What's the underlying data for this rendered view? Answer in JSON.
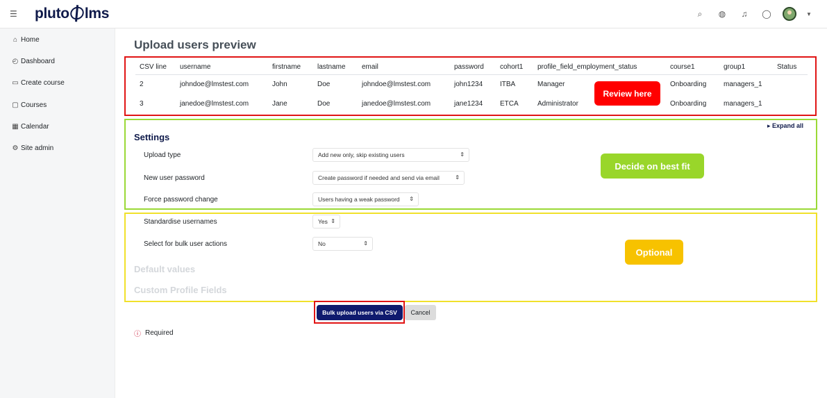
{
  "app": {
    "logo_text_left": "pluto",
    "logo_text_right": "lms"
  },
  "topbar_icons": [
    "search-icon",
    "globe-icon",
    "bell-icon",
    "chat-icon",
    "avatar",
    "chevron-down-icon"
  ],
  "sidebar": {
    "items": [
      {
        "label": "Home",
        "icon": "home-icon"
      },
      {
        "label": "Dashboard",
        "icon": "dashboard-icon"
      },
      {
        "label": "Create course",
        "icon": "monitor-icon"
      },
      {
        "label": "Courses",
        "icon": "folder-icon"
      },
      {
        "label": "Calendar",
        "icon": "calendar-icon"
      },
      {
        "label": "Site admin",
        "icon": "gear-icon"
      }
    ]
  },
  "page": {
    "title": "Upload users preview"
  },
  "preview_table": {
    "headers": [
      "CSV line",
      "username",
      "firstname",
      "lastname",
      "email",
      "password",
      "cohort1",
      "profile_field_employment_status",
      "course1",
      "group1",
      "Status"
    ],
    "rows": [
      [
        "2",
        "johndoe@lmstest.com",
        "John",
        "Doe",
        "johndoe@lmstest.com",
        "john1234",
        "ITBA",
        "Manager",
        "Onboarding",
        "managers_1",
        ""
      ],
      [
        "3",
        "janedoe@lmstest.com",
        "Jane",
        "Doe",
        "janedoe@lmstest.com",
        "jane1234",
        "ETCA",
        "Administrator",
        "Onboarding",
        "managers_1",
        ""
      ]
    ]
  },
  "annotations": {
    "review": "Review here",
    "decide": "Decide on best fit",
    "optional": "Optional"
  },
  "settings": {
    "expand_all": "Expand all",
    "heading": "Settings",
    "fields": [
      {
        "label": "Upload type",
        "value": "Add new only, skip existing users"
      },
      {
        "label": "New user password",
        "value": "Create password if needed and send via email"
      },
      {
        "label": "Force password change",
        "value": "Users having a weak password"
      },
      {
        "label": "Standardise usernames",
        "value": "Yes"
      },
      {
        "label": "Select for bulk user actions",
        "value": "No"
      }
    ],
    "collapsed_sections": [
      "Default values",
      "Custom Profile Fields"
    ]
  },
  "actions": {
    "submit": "Bulk upload users via CSV",
    "cancel": "Cancel"
  },
  "required_note": "Required",
  "colors": {
    "brand_navy": "#0f1a4a",
    "submit_bg": "#0f1a6e",
    "annotation_red": "#ff0000",
    "annotation_green": "#99d62a",
    "annotation_yellow": "#f7c200"
  }
}
